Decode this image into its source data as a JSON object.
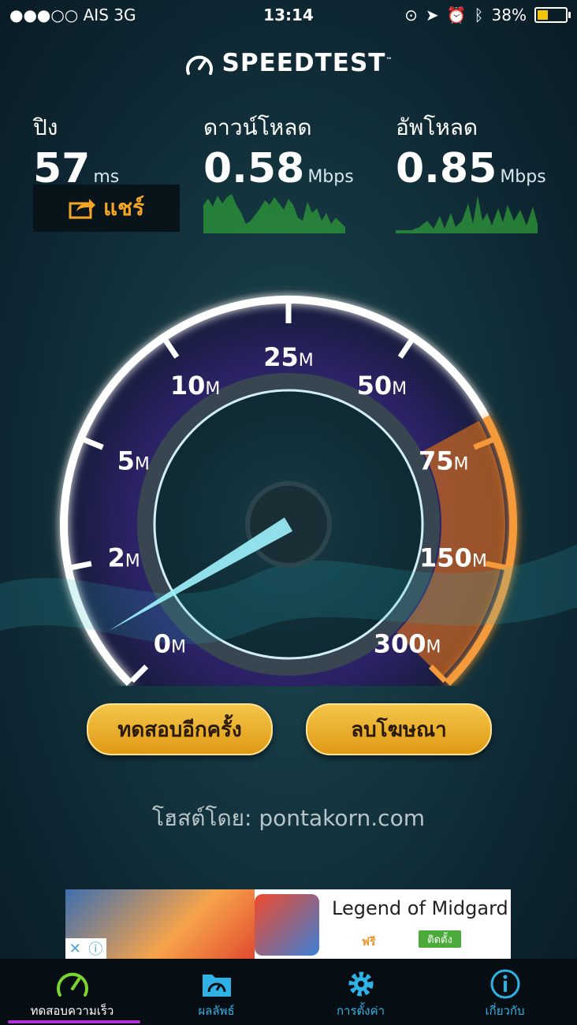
{
  "status_bar": {
    "carrier": "●●●○○ AIS   3G",
    "time": "13:14",
    "battery": "38%",
    "battery_level": 0.38
  },
  "app": {
    "title": "SPEEDTEST"
  },
  "stats": {
    "ping": {
      "label": "ปิง",
      "value": "57",
      "unit": "ms"
    },
    "download": {
      "label": "ดาวน์โหลด",
      "value": "0.58",
      "unit": "Mbps"
    },
    "upload": {
      "label": "อัพโหลด",
      "value": "0.85",
      "unit": "Mbps"
    }
  },
  "share_label": "แชร์",
  "gauge": {
    "unit": "M",
    "ticks": [
      "0",
      "2",
      "5",
      "10",
      "25",
      "50",
      "75",
      "150",
      "300"
    ],
    "needle_value_mbps": 0.85,
    "colors": {
      "ring": "#ffffff",
      "glow_purple": "#8b5bd6",
      "glow_orange": "#f28c28",
      "needle": "#9ff3ff"
    }
  },
  "buttons": {
    "retest": "ทดสอบอีกครั้ง",
    "remove_ads": "ลบโฆษณา"
  },
  "host": "โฮสต์โดย: pontakorn.com",
  "ad": {
    "title": "Legend of Midgard",
    "price": "ฟรี",
    "install": "ติดตั้ง"
  },
  "tabs": [
    {
      "label": "ทดสอบความเร็ว",
      "icon": "speedometer-icon"
    },
    {
      "label": "ผลลัพธ์",
      "icon": "results-folder-icon"
    },
    {
      "label": "การตั้งค่า",
      "icon": "gear-icon"
    },
    {
      "label": "เกี่ยวกับ",
      "icon": "info-icon"
    }
  ]
}
